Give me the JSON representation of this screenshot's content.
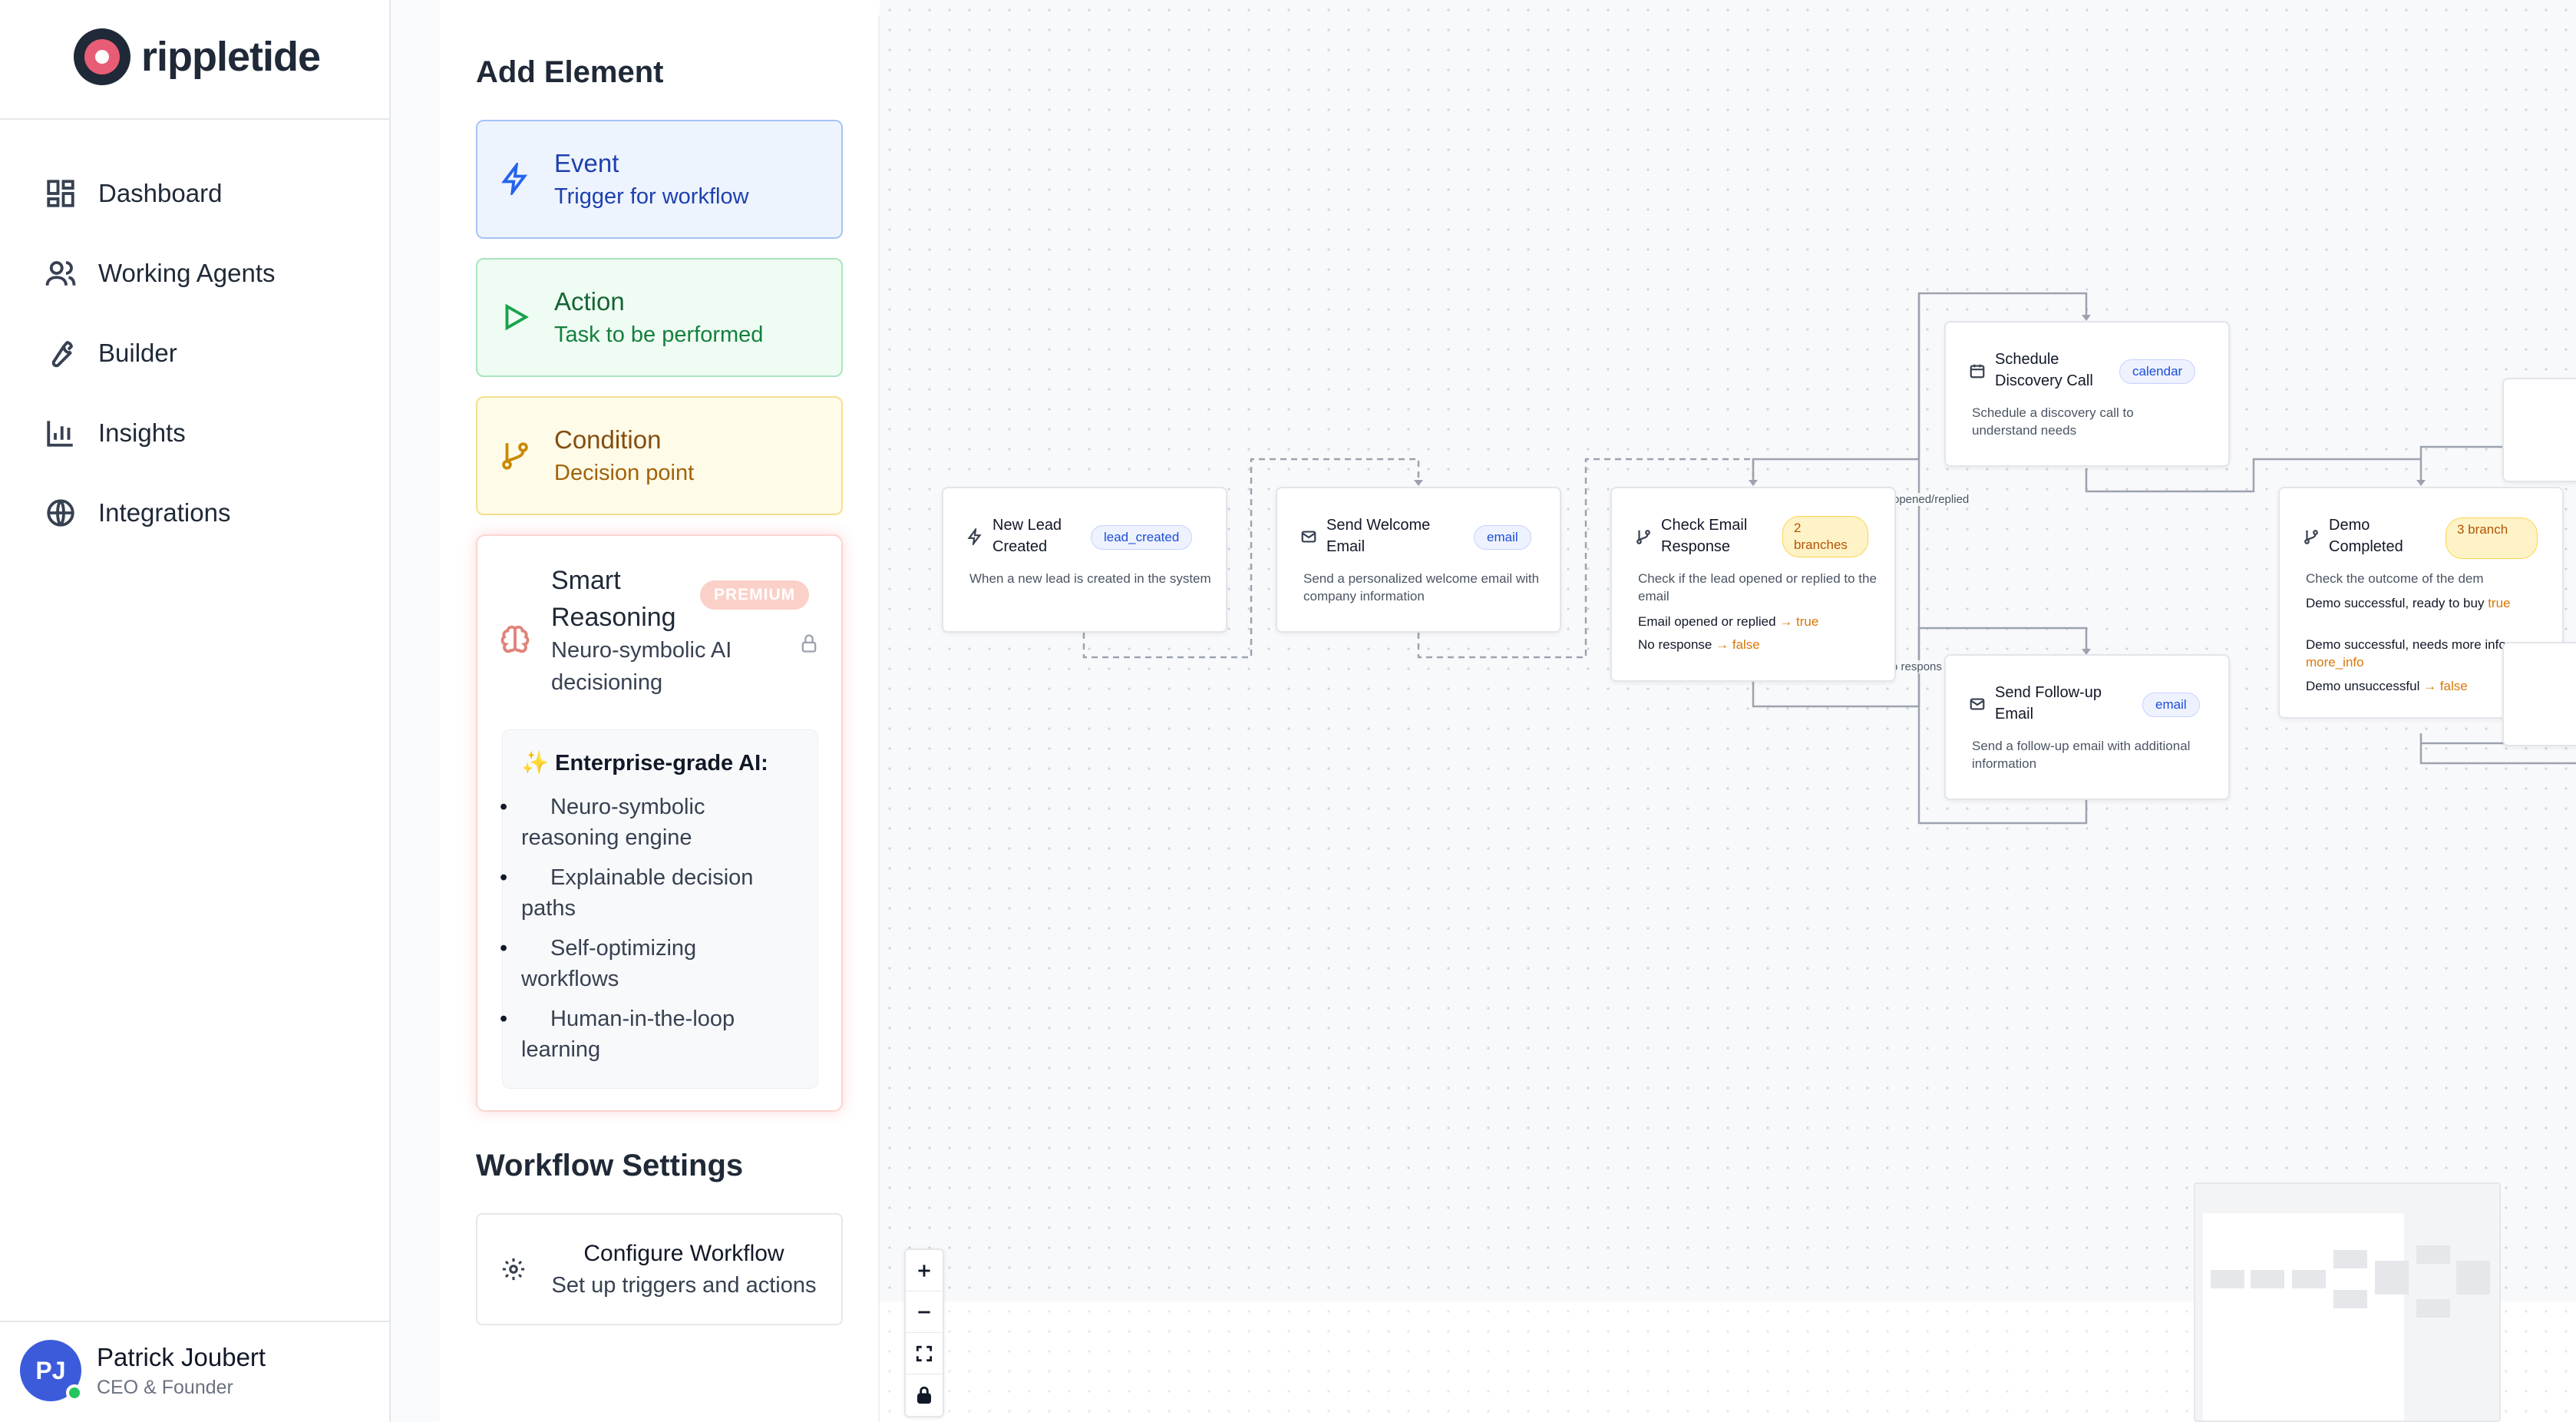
{
  "brand": {
    "name": "rippletide"
  },
  "nav": [
    {
      "label": "Dashboard",
      "icon": "dashboard-icon"
    },
    {
      "label": "Working Agents",
      "icon": "users-icon"
    },
    {
      "label": "Builder",
      "icon": "wrench-icon"
    },
    {
      "label": "Insights",
      "icon": "bar-chart-icon"
    },
    {
      "label": "Integrations",
      "icon": "globe-icon"
    }
  ],
  "user": {
    "initials": "PJ",
    "name": "Patrick Joubert",
    "role": "CEO & Founder",
    "status": "online"
  },
  "panel": {
    "title": "Add Element",
    "elements": [
      {
        "title": "Event",
        "subtitle": "Trigger for workflow",
        "icon": "lightning-icon",
        "color": "#2563eb"
      },
      {
        "title": "Action",
        "subtitle": "Task to be performed",
        "icon": "play-icon",
        "color": "#16a34a"
      },
      {
        "title": "Condition",
        "subtitle": "Decision point",
        "icon": "branch-icon",
        "color": "#ca8a04"
      }
    ],
    "smart": {
      "title": "Smart Reasoning",
      "badge": "PREMIUM",
      "subtitle": "Neuro-symbolic AI decisioning",
      "icon": "brain-icon",
      "locked": true,
      "enterprise_heading": "Enterprise-grade AI:",
      "features": [
        "Neuro-symbolic reasoning engine",
        "Explainable decision paths",
        "Self-optimizing workflows",
        "Human-in-the-loop learning"
      ]
    },
    "settings_title": "Workflow Settings",
    "configure": {
      "title": "Configure Workflow",
      "subtitle": "Set up triggers and actions"
    }
  },
  "workflow": {
    "nodes": {
      "new_lead": {
        "title": "New Lead Created",
        "badge": "lead_created",
        "description": "When a new lead is created in the system"
      },
      "welcome": {
        "title": "Send Welcome Email",
        "badge": "email",
        "description": "Send a personalized welcome email with company information"
      },
      "check": {
        "title": "Check Email Response",
        "badge": "2 branches",
        "description": "Check if the lead opened or replied to the email",
        "outcomes": [
          {
            "label": "Email opened or replied",
            "result": "→ true"
          },
          {
            "label": "No response",
            "result": "→ false"
          }
        ]
      },
      "schedule": {
        "title": "Schedule Discovery Call",
        "badge": "calendar",
        "description": "Schedule a discovery call to understand needs"
      },
      "followup": {
        "title": "Send Follow-up Email",
        "badge": "email",
        "description": "Send a follow-up email with additional information"
      },
      "demo": {
        "title": "Demo Completed",
        "badge": "3 branch",
        "description": "Check the outcome of the dem",
        "outcomes": [
          {
            "label": "Demo successful, ready to buy",
            "result": "true"
          },
          {
            "label": "Demo successful, needs more info",
            "result": "→ more_info"
          },
          {
            "label": "Demo unsuccessful",
            "result": "→ false"
          }
        ]
      }
    },
    "edge_labels": {
      "opened": "opened/replied",
      "no_response": "o respons"
    }
  },
  "controls": [
    {
      "name": "zoom-in-button",
      "icon": "plus-icon"
    },
    {
      "name": "zoom-out-button",
      "icon": "minus-icon"
    },
    {
      "name": "fit-view-button",
      "icon": "fit-icon"
    },
    {
      "name": "lock-button",
      "icon": "lock-icon"
    }
  ]
}
